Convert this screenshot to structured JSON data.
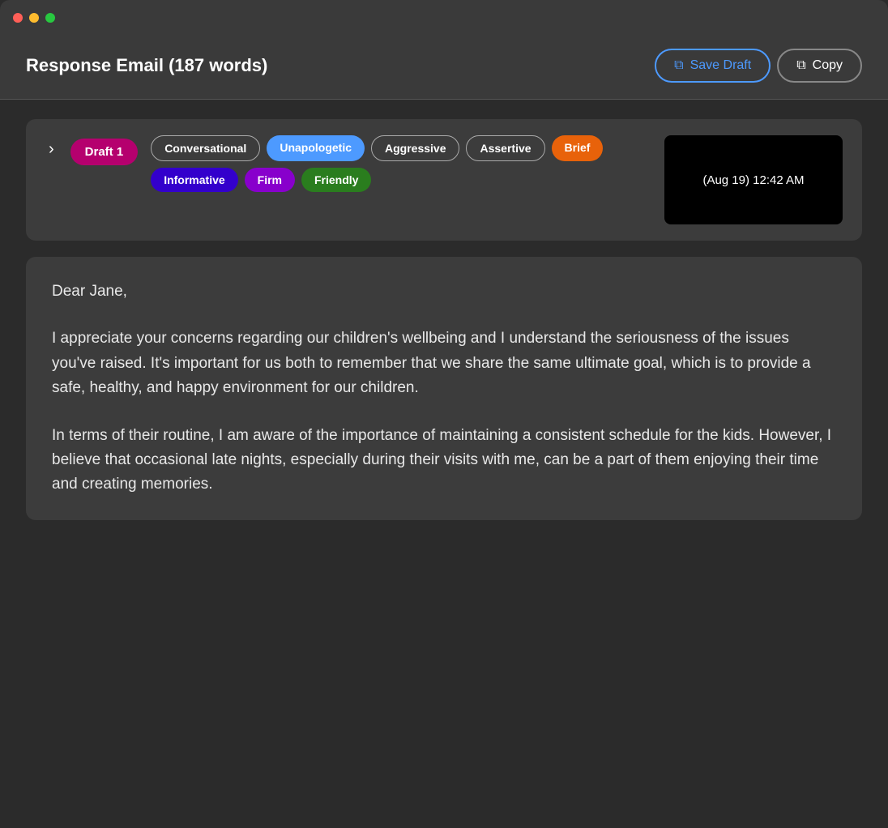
{
  "titlebar": {
    "lights": [
      "red",
      "yellow",
      "green"
    ]
  },
  "header": {
    "title": "Response Email (187 words)",
    "save_draft_label": "Save Draft",
    "copy_label": "Copy"
  },
  "draft": {
    "badge_label": "Draft 1",
    "timestamp": "(Aug 19) 12:42 AM",
    "tone_tags": [
      {
        "label": "Conversational",
        "style": "conversational"
      },
      {
        "label": "Unapologetic",
        "style": "unapologetic"
      },
      {
        "label": "Aggressive",
        "style": "aggressive"
      },
      {
        "label": "Assertive",
        "style": "assertive"
      },
      {
        "label": "Brief",
        "style": "brief"
      },
      {
        "label": "Informative",
        "style": "informative"
      },
      {
        "label": "Firm",
        "style": "firm"
      },
      {
        "label": "Friendly",
        "style": "friendly"
      }
    ]
  },
  "email": {
    "greeting": "Dear Jane,",
    "paragraph1": "I appreciate your concerns regarding our children's wellbeing and I understand the seriousness of the issues you've raised. It's important for us both to remember that we share the same ultimate goal, which is to provide a safe, healthy, and happy environment for our children.",
    "paragraph2": "In terms of their routine, I am aware of the importance of maintaining a consistent schedule for the kids. However, I believe that occasional late nights, especially during their visits with me, can be a part of them enjoying their time and creating memories."
  }
}
